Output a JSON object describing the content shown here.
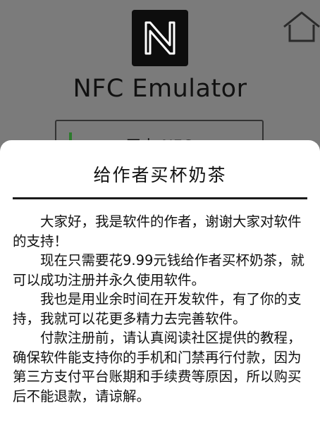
{
  "app": {
    "title": "NFC Emulator",
    "read_button_label": "无卡 NFC"
  },
  "dialog": {
    "title": "给作者买杯奶茶",
    "paragraphs": [
      "大家好，我是软件的作者，谢谢大家对软件的支持！",
      "现在只需要花9.99元钱给作者买杯奶茶，就可以成功注册并永久使用软件。",
      "我也是用业余时间在开发软件，有了你的支持，我就可以花更多精力去完善软件。",
      "付款注册前，请认真阅读社区提供的教程，确保软件能支持你的手机和门禁再行付款，因为第三方支付平台账期和手续费等原因，所以购买后不能退款，请谅解。"
    ]
  },
  "icons": {
    "logo": "nfc-n-logo",
    "home": "home-icon"
  },
  "colors": {
    "overlay_bg": "#7b7b7b",
    "dialog_bg": "#ffffff",
    "text": "#111111"
  }
}
